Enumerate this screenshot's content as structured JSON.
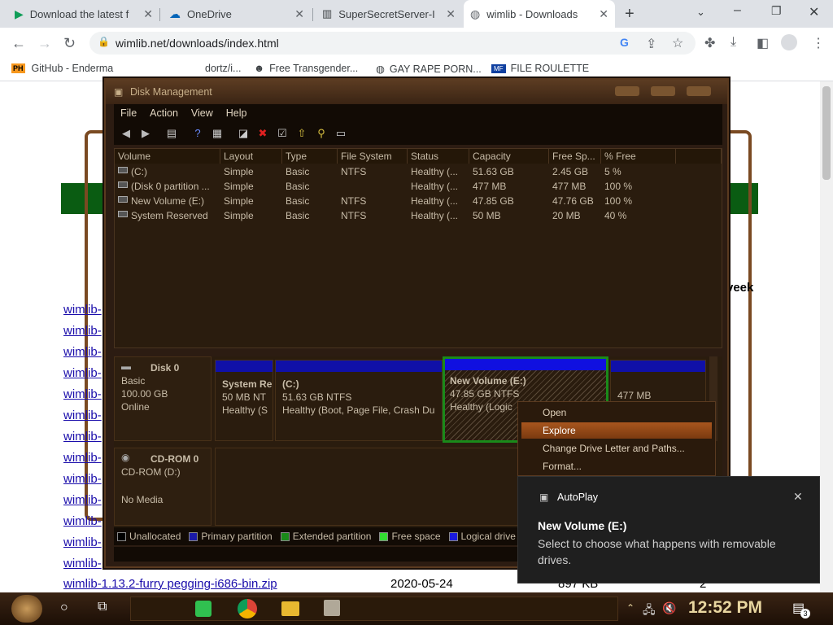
{
  "browser": {
    "tabs": [
      {
        "label": "Download the latest f",
        "icon": "play-icon"
      },
      {
        "label": "OneDrive",
        "icon": "cloud-icon"
      },
      {
        "label": "SuperSecretServer-I",
        "icon": "server-icon"
      },
      {
        "label": "wimlib - Downloads",
        "icon": "globe-icon"
      }
    ],
    "new_tab": "+",
    "url": "wimlib.net/downloads/index.html",
    "bookmarks": [
      {
        "label": "GitHub - Enderma",
        "icon": "PH"
      },
      {
        "label": "dortz/i..."
      },
      {
        "label": "Free Transgender..."
      },
      {
        "label": "GAY RAPE PORN..."
      },
      {
        "label": "FILE ROULETTE"
      }
    ]
  },
  "page": {
    "partial_text": "veek",
    "links": [
      "wimlib-",
      "wimlib-",
      "wimlib-",
      "wimlib-",
      "wimlib-",
      "wimlib-",
      "wimlib-",
      "wimlib-",
      "wimlib-",
      "wimlib-",
      "wimlib-",
      "wimlib-",
      "wimlib-"
    ],
    "last_row": {
      "name": "wimlib-1.13.2-furry pegging-i686-bin.zip",
      "date": "2020-05-24",
      "size": "897 KB",
      "count": "2"
    }
  },
  "disk_management": {
    "title": "Disk Management",
    "menu": [
      "File",
      "Action",
      "View",
      "Help"
    ],
    "columns": [
      "Volume",
      "Layout",
      "Type",
      "File System",
      "Status",
      "Capacity",
      "Free Sp...",
      "% Free"
    ],
    "rows": [
      [
        "(C:)",
        "Simple",
        "Basic",
        "NTFS",
        "Healthy (...",
        "51.63 GB",
        "2.45 GB",
        "5 %"
      ],
      [
        "(Disk 0 partition ...",
        "Simple",
        "Basic",
        "",
        "Healthy (...",
        "477 MB",
        "477 MB",
        "100 %"
      ],
      [
        "New Volume (E:)",
        "Simple",
        "Basic",
        "NTFS",
        "Healthy (...",
        "47.85 GB",
        "47.76 GB",
        "100 %"
      ],
      [
        "System Reserved",
        "Simple",
        "Basic",
        "NTFS",
        "Healthy (...",
        "50 MB",
        "20 MB",
        "40 %"
      ]
    ],
    "disk0": {
      "name": "Disk 0",
      "type": "Basic",
      "size": "100.00 GB",
      "state": "Online"
    },
    "partitions": [
      {
        "name": "System Re",
        "size": "50 MB NT",
        "status": "Healthy (S"
      },
      {
        "name": "(C:)",
        "size": "51.63 GB NTFS",
        "status": "Healthy (Boot, Page File, Crash Du"
      },
      {
        "name": "New Volume  (E:)",
        "size": "47.85 GB NTFS",
        "status": "Healthy (Logic"
      },
      {
        "name": "",
        "size": "477 MB",
        "status": ""
      }
    ],
    "cdrom": {
      "name": "CD-ROM 0",
      "drive": "CD-ROM (D:)",
      "state": "No Media"
    },
    "legend": [
      {
        "label": "Unallocated",
        "color": "#000000"
      },
      {
        "label": "Primary partition",
        "color": "#1a1aa8"
      },
      {
        "label": "Extended partition",
        "color": "#1a8a1a"
      },
      {
        "label": "Free space",
        "color": "#33dd33"
      },
      {
        "label": "Logical drive",
        "color": "#1a1add"
      }
    ]
  },
  "context_menu": [
    "Open",
    "Explore",
    "Change Drive Letter and Paths...",
    "Format..."
  ],
  "autoplay": {
    "app": "AutoPlay",
    "title": "New Volume (E:)",
    "message": "Select to choose what happens with removable drives."
  },
  "taskbar": {
    "time": "12:52 PM",
    "notifications": "3"
  }
}
